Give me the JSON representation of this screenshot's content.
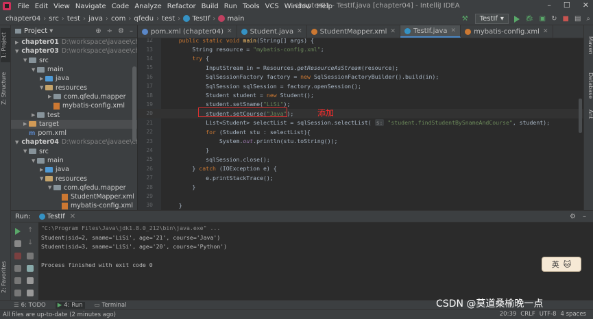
{
  "menubar": {
    "items": [
      "File",
      "Edit",
      "View",
      "Navigate",
      "Code",
      "Analyze",
      "Refactor",
      "Build",
      "Run",
      "Tools",
      "VCS",
      "Window",
      "Help"
    ],
    "window_title": "chapter01 - TestIf.java [chapter04] - IntelliJ IDEA"
  },
  "navbar": {
    "crumbs": [
      "chapter04",
      "src",
      "test",
      "java",
      "com",
      "qfedu",
      "test",
      "TestIf",
      "main"
    ],
    "run_config": "TestIf"
  },
  "left_tools": {
    "project": "1: Project",
    "structure": "Z: Structure",
    "favorites": "2: Favorites"
  },
  "right_tools": {
    "maven": "Maven",
    "database": "Database",
    "ant": "Ant"
  },
  "project": {
    "title": "Project",
    "tree": [
      {
        "label": "chapter01",
        "path": "D:\\workspace\\javaee\\chapter01",
        "kind": "module",
        "indent": 0,
        "arrow": "▶"
      },
      {
        "label": "chapter03",
        "path": "D:\\workspace\\javaee\\chapter03",
        "kind": "module",
        "indent": 0,
        "arrow": "▼"
      },
      {
        "label": "src",
        "path": "",
        "kind": "folder",
        "indent": 1,
        "arrow": "▼"
      },
      {
        "label": "main",
        "path": "",
        "kind": "folder",
        "indent": 2,
        "arrow": "▼"
      },
      {
        "label": "java",
        "path": "",
        "kind": "src",
        "indent": 3,
        "arrow": "▶"
      },
      {
        "label": "resources",
        "path": "",
        "kind": "res",
        "indent": 3,
        "arrow": "▼"
      },
      {
        "label": "com.qfedu.mapper",
        "path": "",
        "kind": "folder",
        "indent": 4,
        "arrow": "▶"
      },
      {
        "label": "mybatis-config.xml",
        "path": "",
        "kind": "xml",
        "indent": 4,
        "arrow": ""
      },
      {
        "label": "test",
        "path": "",
        "kind": "folder",
        "indent": 2,
        "arrow": "▶"
      },
      {
        "label": "target",
        "path": "",
        "kind": "target",
        "indent": 1,
        "arrow": "▶",
        "selected": true
      },
      {
        "label": "pom.xml",
        "path": "",
        "kind": "pom",
        "indent": 1,
        "arrow": ""
      },
      {
        "label": "chapter04",
        "path": "D:\\workspace\\javaee\\chapter04",
        "kind": "module",
        "indent": 0,
        "arrow": "▼"
      },
      {
        "label": "src",
        "path": "",
        "kind": "folder",
        "indent": 1,
        "arrow": "▼"
      },
      {
        "label": "main",
        "path": "",
        "kind": "folder",
        "indent": 2,
        "arrow": "▼"
      },
      {
        "label": "java",
        "path": "",
        "kind": "src",
        "indent": 3,
        "arrow": "▶"
      },
      {
        "label": "resources",
        "path": "",
        "kind": "res",
        "indent": 3,
        "arrow": "▼"
      },
      {
        "label": "com.qfedu.mapper",
        "path": "",
        "kind": "folder",
        "indent": 4,
        "arrow": "▼"
      },
      {
        "label": "StudentMapper.xml",
        "path": "",
        "kind": "xml",
        "indent": 5,
        "arrow": ""
      },
      {
        "label": "mybatis-config.xml",
        "path": "",
        "kind": "xml",
        "indent": 5,
        "arrow": ""
      }
    ]
  },
  "tabs": [
    {
      "label": "pom.xml (chapter04)",
      "icon": "maven-icon",
      "color": "#5a87c8",
      "active": false
    },
    {
      "label": "Student.java",
      "icon": "class-icon",
      "color": "#3592c4",
      "active": false
    },
    {
      "label": "StudentMapper.xml",
      "icon": "xml-icon",
      "color": "#cc7832",
      "active": false
    },
    {
      "label": "TestIf.java",
      "icon": "class-icon",
      "color": "#3592c4",
      "active": true
    },
    {
      "label": "mybatis-config.xml",
      "icon": "xml-icon",
      "color": "#cc7832",
      "active": false
    }
  ],
  "editor": {
    "lines": [
      {
        "n": "12",
        "html": "    <span class='kw'>public static void</span> <span class='fn'>main</span>(String[] args) {"
      },
      {
        "n": "13",
        "html": "        String resource = <span class='str'>\"mybatis-config.xml\"</span>;"
      },
      {
        "n": "14",
        "html": "        <span class='kw'>try</span> {"
      },
      {
        "n": "15",
        "html": "            InputStream in = Resources.<span class='it'>getResourceAsStream</span>(resource);"
      },
      {
        "n": "16",
        "html": "            SqlSessionFactory factory = <span class='kw'>new</span> SqlSessionFactoryBuilder().build(in);"
      },
      {
        "n": "17",
        "html": "            SqlSession sqlSession = factory.openSession();"
      },
      {
        "n": "18",
        "html": "            Student student = <span class='kw'>new</span> Student();"
      },
      {
        "n": "19",
        "html": "            student.setSname(<span class='str'>\"LiSi\"</span>);"
      },
      {
        "n": "20",
        "html": "            student.setCourse(<span class='str'>\"Java\"</span>);",
        "current": true
      },
      {
        "n": "21",
        "html": "            List&lt;Student&gt; selectList = sqlSession.selectList( <span class='hint'>s:</span> <span class='str'>\"student.findStudentBySnameAndCourse\"</span>, student);"
      },
      {
        "n": "22",
        "html": "            <span class='kw'>for</span> (Student stu : selectList){"
      },
      {
        "n": "23",
        "html": "                System.<span class='fld'>out</span>.println(stu.toString());"
      },
      {
        "n": "24",
        "html": "            }"
      },
      {
        "n": "25",
        "html": "            sqlSession.close();"
      },
      {
        "n": "26",
        "html": "        } <span class='kw'>catch</span> (IOException e) {"
      },
      {
        "n": "27",
        "html": "            e.printStackTrace();"
      },
      {
        "n": "28",
        "html": "        }"
      },
      {
        "n": "29",
        "html": ""
      },
      {
        "n": "30",
        "html": "    }"
      }
    ],
    "annotation": "添加"
  },
  "run": {
    "label": "Run:",
    "tab": "TestIf",
    "console": [
      {
        "text": "\"C:\\Program Files\\Java\\jdk1.8.0_212\\bin\\java.exe\" ...",
        "cls": "cmd"
      },
      {
        "text": "Student(sid=2, sname='LiSi', age='21', course='Java')",
        "cls": ""
      },
      {
        "text": "Student(sid=3, sname='LiSi', age='20', course='Python')",
        "cls": ""
      },
      {
        "text": "",
        "cls": ""
      },
      {
        "text": "Process finished with exit code 0",
        "cls": ""
      }
    ]
  },
  "ime": {
    "label": "英"
  },
  "toolwindows": [
    {
      "label": "6: TODO",
      "active": false
    },
    {
      "label": "4: Run",
      "active": true
    },
    {
      "label": "Terminal",
      "active": false
    }
  ],
  "status": {
    "message": "All files are up-to-date (2 minutes ago)",
    "position": "20:39",
    "line_sep": "CRLF",
    "encoding": "UTF-8",
    "indent": "4 spaces"
  },
  "watermark": "CSDN @莫道桑榆晚一点",
  "colors": {
    "accent": "#4a88c7",
    "run_green": "#59a869",
    "annotation_red": "#ff2d2d"
  }
}
